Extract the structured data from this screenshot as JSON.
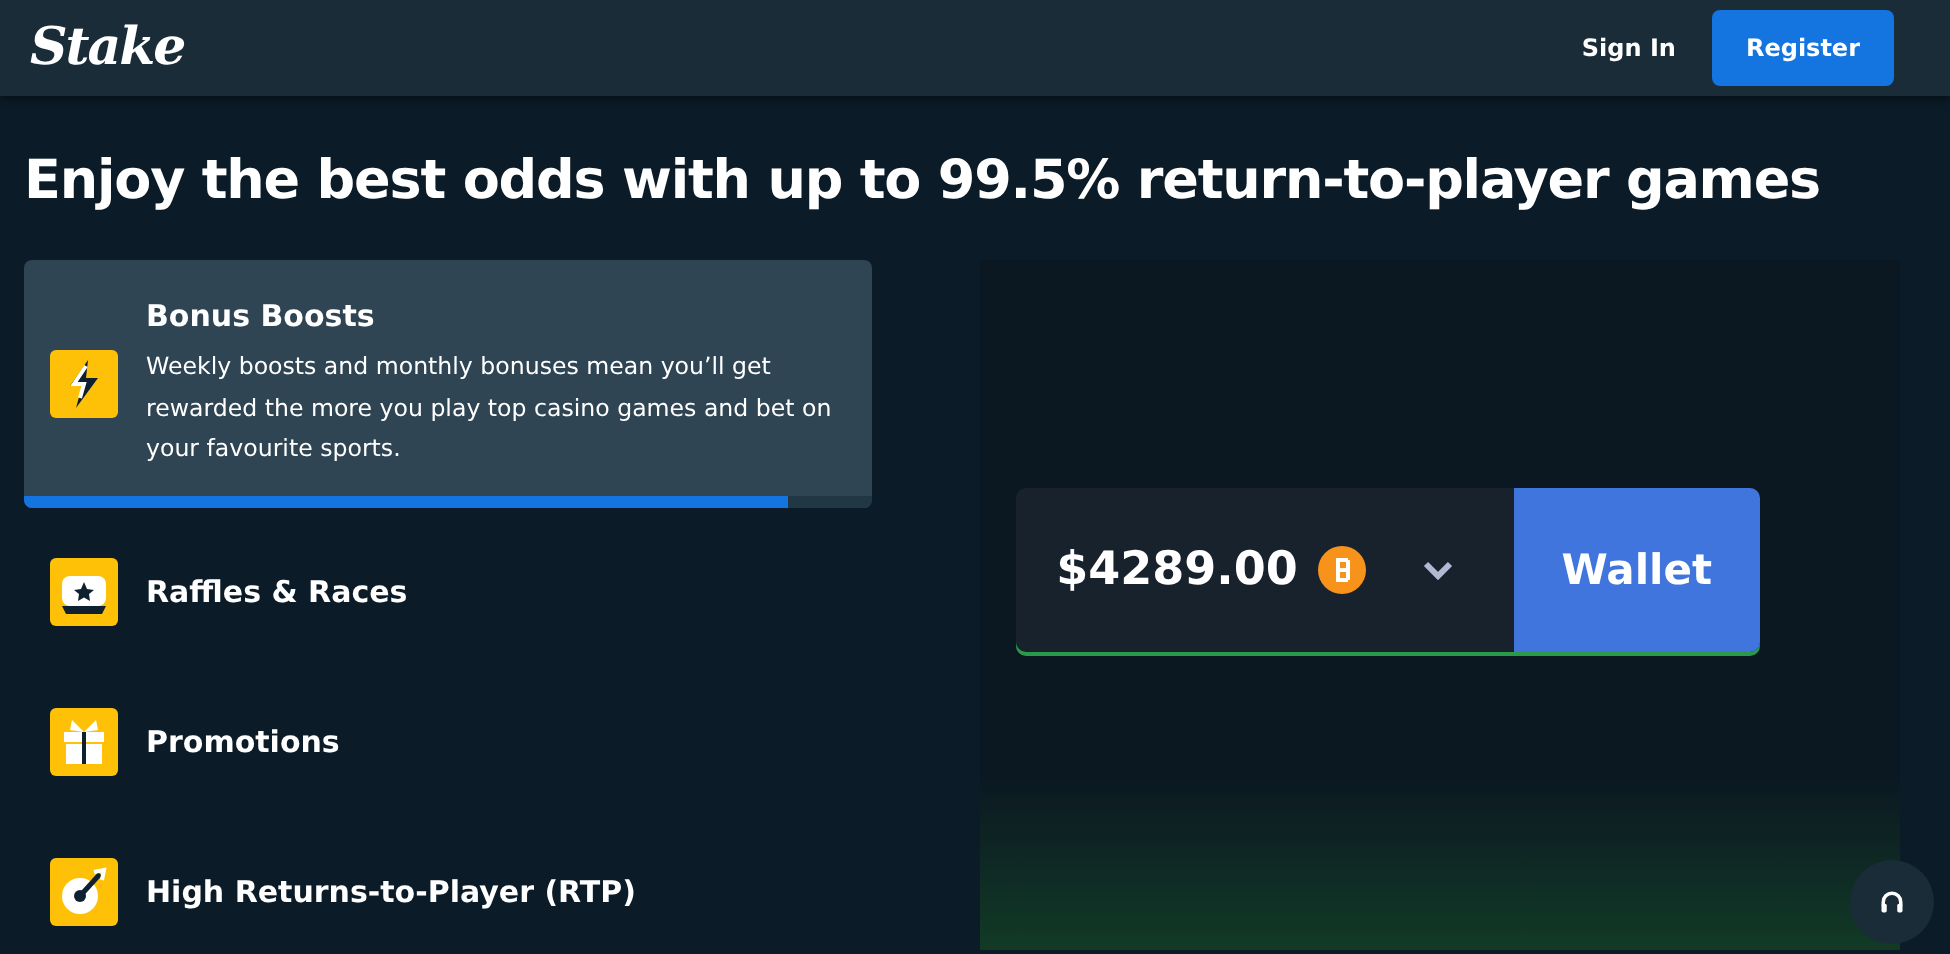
{
  "header": {
    "logo": "Stake",
    "sign_in": "Sign In",
    "register": "Register"
  },
  "headline": "Enjoy the best odds with up to 99.5% return-to-player games",
  "features": [
    {
      "title": "Bonus Boosts",
      "selected": true,
      "description": "Weekly boosts and monthly bonuses mean you’ll get rewarded the more you play top casino games and bet on your favourite sports.",
      "level": 0.9
    },
    {
      "title": "Raffles & Races",
      "selected": false
    },
    {
      "title": "Promotions",
      "selected": false
    },
    {
      "title": "High Returns-to-Player (RTP)",
      "selected": false
    }
  ],
  "wallet": {
    "balance": "$4289.00",
    "button": "Wallet"
  }
}
